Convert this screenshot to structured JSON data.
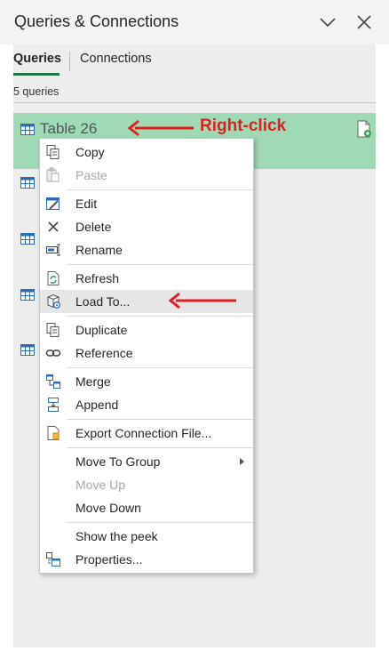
{
  "pane": {
    "title": "Queries & Connections"
  },
  "tabs": [
    {
      "label": "Queries",
      "active": true
    },
    {
      "label": "Connections",
      "active": false
    }
  ],
  "query_count": "5 queries",
  "selected_query": {
    "name": "Table 26"
  },
  "annotation": {
    "text": "Right-click",
    "color": "#e02020"
  },
  "menu": {
    "items": [
      {
        "label": "Copy",
        "icon": "copy-icon",
        "enabled": true
      },
      {
        "label": "Paste",
        "icon": "paste-icon",
        "enabled": false
      },
      {
        "label": "Edit",
        "icon": "edit-icon",
        "enabled": true
      },
      {
        "label": "Delete",
        "icon": "delete-icon",
        "enabled": true
      },
      {
        "label": "Rename",
        "icon": "rename-icon",
        "enabled": true
      },
      {
        "label": "Refresh",
        "icon": "refresh-icon",
        "enabled": true
      },
      {
        "label": "Load To...",
        "icon": "load-to-icon",
        "enabled": true,
        "highlighted": true
      },
      {
        "label": "Duplicate",
        "icon": "duplicate-icon",
        "enabled": true
      },
      {
        "label": "Reference",
        "icon": "reference-icon",
        "enabled": true
      },
      {
        "label": "Merge",
        "icon": "merge-icon",
        "enabled": true
      },
      {
        "label": "Append",
        "icon": "append-icon",
        "enabled": true
      },
      {
        "label": "Export Connection File...",
        "icon": "export-file-icon",
        "enabled": true
      },
      {
        "label": "Move To Group",
        "icon": "",
        "enabled": true,
        "submenu": true
      },
      {
        "label": "Move Up",
        "icon": "",
        "enabled": false
      },
      {
        "label": "Move Down",
        "icon": "",
        "enabled": true
      },
      {
        "label": "Show the peek",
        "icon": "",
        "enabled": true
      },
      {
        "label": "Properties...",
        "icon": "properties-icon",
        "enabled": true
      }
    ]
  },
  "colors": {
    "accent": "#217346",
    "selected_row": "#a0d9b6",
    "annotation": "#e02020"
  }
}
